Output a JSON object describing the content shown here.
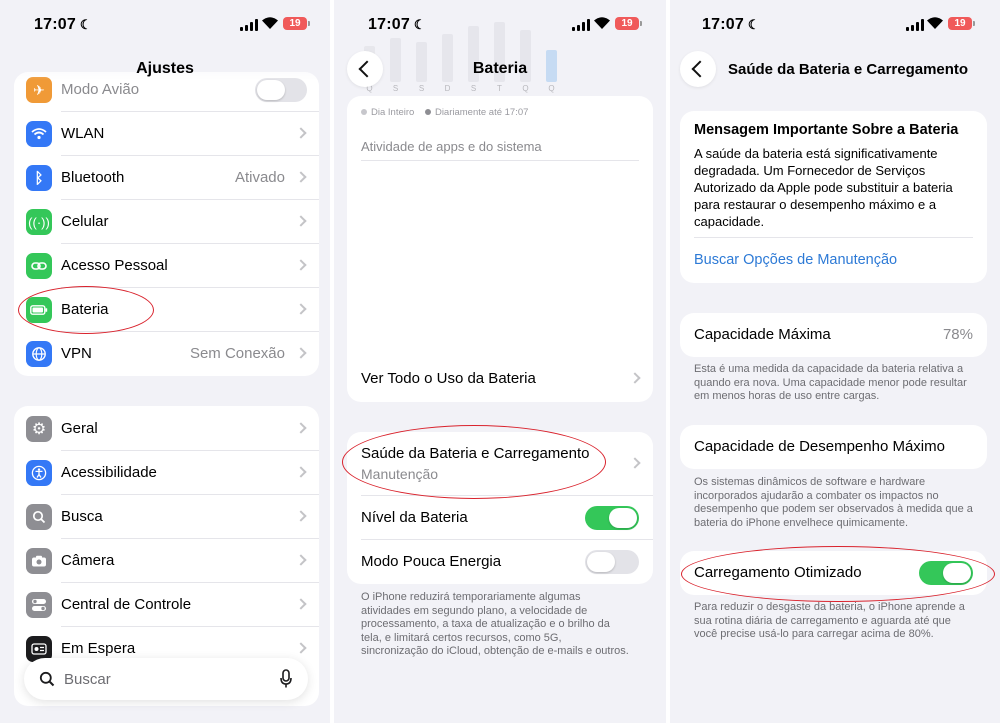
{
  "status": {
    "time": "17:07",
    "battery": "19"
  },
  "panel1": {
    "title": "Ajustes",
    "group1": [
      {
        "label": "Modo Avião",
        "value": "",
        "icon": "airplane-icon",
        "color": "#f09a37"
      },
      {
        "label": "WLAN",
        "value": "",
        "icon": "wifi-icon",
        "color": "#3478f6"
      },
      {
        "label": "Bluetooth",
        "value": "Ativado",
        "icon": "bluetooth-icon",
        "color": "#3478f6"
      },
      {
        "label": "Celular",
        "value": "",
        "icon": "antenna-icon",
        "color": "#34c759"
      },
      {
        "label": "Acesso Pessoal",
        "value": "",
        "icon": "link-icon",
        "color": "#34c759"
      },
      {
        "label": "Bateria",
        "value": "",
        "icon": "battery-icon",
        "color": "#34c759"
      },
      {
        "label": "VPN",
        "value": "Sem Conexão",
        "icon": "globe-icon",
        "color": "#3478f6"
      }
    ],
    "group2": [
      {
        "label": "Geral",
        "icon": "gear-icon",
        "color": "#8e8e93"
      },
      {
        "label": "Acessibilidade",
        "icon": "accessibility-icon",
        "color": "#3478f6"
      },
      {
        "label": "Busca",
        "icon": "search-icon",
        "color": "#8e8e93"
      },
      {
        "label": "Câmera",
        "icon": "camera-icon",
        "color": "#8e8e93"
      },
      {
        "label": "Central de Controle",
        "icon": "control-center-icon",
        "color": "#8e8e93"
      },
      {
        "label": "Em Espera",
        "icon": "standby-icon",
        "color": "#1c1c1e"
      }
    ],
    "search_placeholder": "Buscar"
  },
  "panel2": {
    "title": "Bateria",
    "chart_days": [
      "Q",
      "S",
      "S",
      "D",
      "S",
      "T",
      "Q",
      "Q"
    ],
    "chart_bars": [
      0.45,
      0.55,
      0.5,
      0.6,
      0.7,
      0.75,
      0.65,
      0.4
    ],
    "legend_all_day": "Dia Inteiro",
    "legend_daily": "Diariamente até 17:07",
    "activity_header": "Atividade de apps e do sistema",
    "see_all": "Ver Todo o Uso da Bateria",
    "health_title": "Saúde da Bateria e Carregamento",
    "health_subtitle": "Manutenção",
    "battery_level": "Nível da Bateria",
    "battery_level_on": true,
    "low_power": "Modo Pouca Energia",
    "low_power_on": false,
    "low_power_footer": "O iPhone reduzirá temporariamente algumas atividades em segundo plano, a velocidade de processamento, a taxa de atualização e o brilho da tela, e limitará certos recursos, como 5G, sincronização do iCloud, obtenção de e-mails e outros."
  },
  "panel3": {
    "title": "Saúde da Bateria e Carregamento",
    "msg_title": "Mensagem Importante Sobre a Bateria",
    "msg_body": "A saúde da bateria está significativamente degradada. Um Fornecedor de Serviços Autorizado da Apple pode substituir a bateria para restaurar o desempenho máximo e a capacidade.",
    "msg_link": "Buscar Opções de Manutenção",
    "max_capacity_label": "Capacidade Máxima",
    "max_capacity_value": "78%",
    "max_capacity_footer": "Esta é uma medida da capacidade da bateria relativa a quando era nova. Uma capacidade menor pode resultar em menos horas de uso entre cargas.",
    "peak_label": "Capacidade de Desempenho Máximo",
    "peak_footer": "Os sistemas dinâmicos de software e hardware incorporados ajudarão a combater os impactos no desempenho que podem ser observados à medida que a bateria do iPhone envelhece quimicamente.",
    "optimized_label": "Carregamento Otimizado",
    "optimized_on": true,
    "optimized_footer": "Para reduzir o desgaste da bateria, o iPhone aprende a sua rotina diária de carregamento e aguarda até que você precise usá-lo para carregar acima de 80%."
  }
}
